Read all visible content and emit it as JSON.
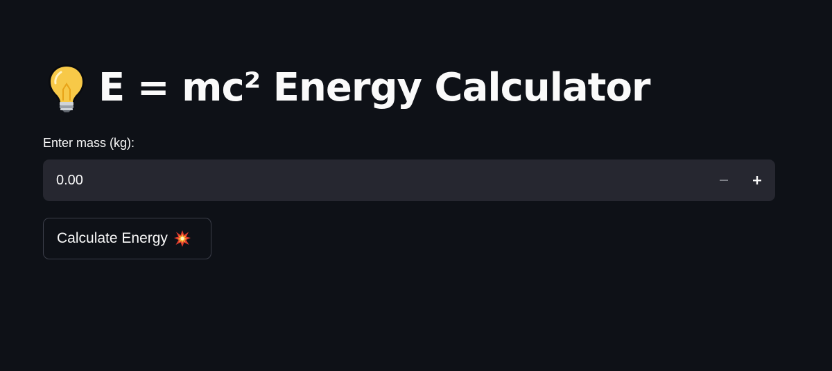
{
  "header": {
    "title": "E = mc² Energy Calculator",
    "title_icon": "lightbulb-icon"
  },
  "mass_input": {
    "label": "Enter mass (kg):",
    "value": "0.00",
    "decrement_label": "−",
    "increment_label": "+"
  },
  "calculate_button": {
    "label": "Calculate Energy",
    "icon": "collision-icon"
  },
  "colors": {
    "background": "#0e1117",
    "input_background": "#262730",
    "text": "#fafafa",
    "button_border": "#3c3f4a"
  }
}
